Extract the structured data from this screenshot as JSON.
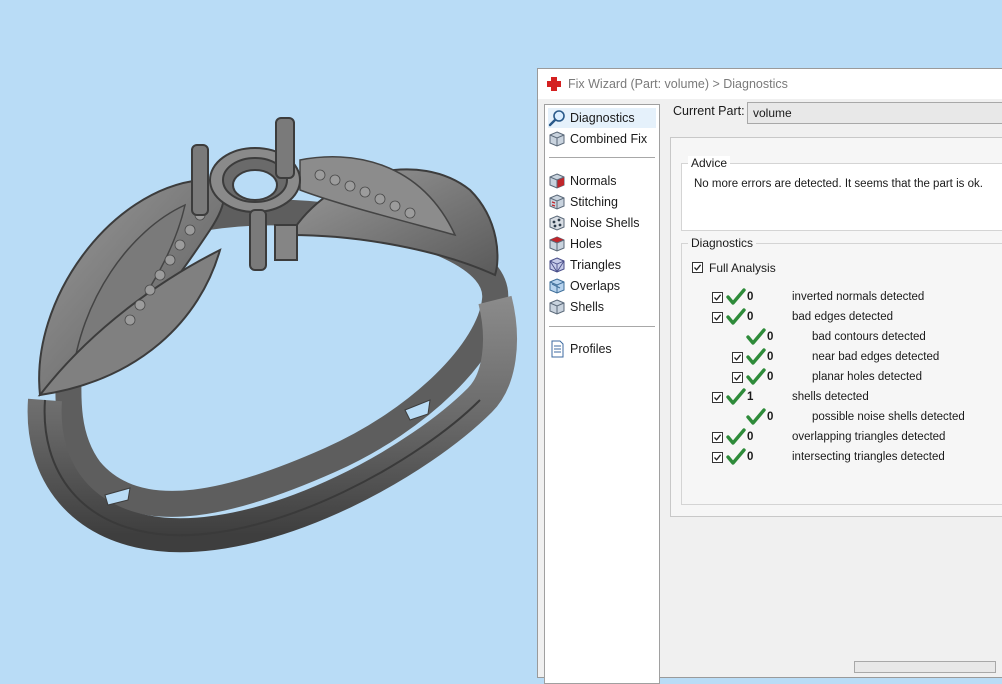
{
  "dialog": {
    "title": "Fix Wizard (Part: volume) > Diagnostics"
  },
  "nav": {
    "items": [
      {
        "label": "Diagnostics",
        "icon": "magnifier-icon"
      },
      {
        "label": "Combined Fix",
        "icon": "cube-icon"
      },
      {
        "label": "Normals",
        "icon": "normals-cube-icon"
      },
      {
        "label": "Stitching",
        "icon": "stitching-cube-icon"
      },
      {
        "label": "Noise Shells",
        "icon": "noise-shells-icon"
      },
      {
        "label": "Holes",
        "icon": "holes-cube-icon"
      },
      {
        "label": "Triangles",
        "icon": "triangles-cube-icon"
      },
      {
        "label": "Overlaps",
        "icon": "overlaps-cube-icon"
      },
      {
        "label": "Shells",
        "icon": "shells-cube-icon"
      },
      {
        "label": "Profiles",
        "icon": "document-icon"
      }
    ]
  },
  "current_part": {
    "label": "Current Part:",
    "value": "volume"
  },
  "advice": {
    "title": "Advice",
    "text": "No more errors are detected. It seems that the part is ok."
  },
  "diagnostics": {
    "title": "Diagnostics",
    "full_analysis_label": "Full Analysis",
    "rows": [
      {
        "count": "0",
        "label": "inverted normals detected",
        "checkbox": true,
        "level": 0
      },
      {
        "count": "0",
        "label": "bad edges detected",
        "checkbox": true,
        "level": 0
      },
      {
        "count": "0",
        "label": "bad contours detected",
        "checkbox": false,
        "level": 1
      },
      {
        "count": "0",
        "label": "near bad edges detected",
        "checkbox": true,
        "level": 1
      },
      {
        "count": "0",
        "label": "planar holes detected",
        "checkbox": true,
        "level": 1
      },
      {
        "count": "1",
        "label": "shells detected",
        "checkbox": true,
        "level": 0
      },
      {
        "count": "0",
        "label": "possible noise shells detected",
        "checkbox": false,
        "level": 1
      },
      {
        "count": "0",
        "label": "overlapping triangles detected",
        "checkbox": true,
        "level": 0
      },
      {
        "count": "0",
        "label": "intersecting triangles detected",
        "checkbox": true,
        "level": 0
      }
    ]
  },
  "colors": {
    "viewport_bg": "#b9dcf6",
    "check_green": "#2e8b3a",
    "model_gray": "#6e6e6e"
  }
}
